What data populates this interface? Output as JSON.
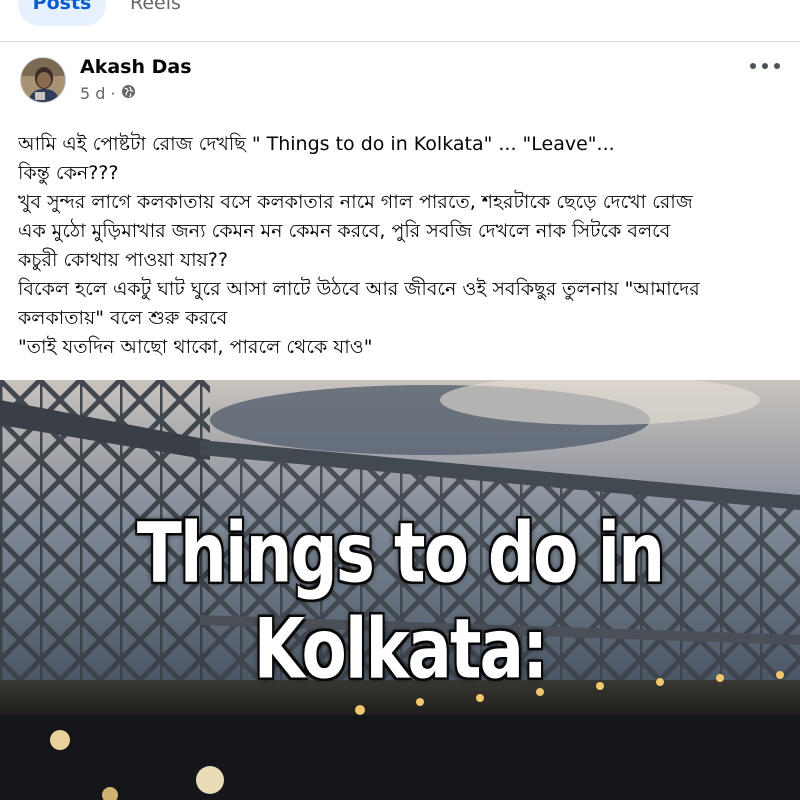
{
  "tabs": [
    {
      "label": "Posts",
      "active": true
    },
    {
      "label": "Reels",
      "active": false
    }
  ],
  "post": {
    "author": "Akash Das",
    "time": "5 d",
    "separator": "·",
    "audience_icon": "globe-icon",
    "more_icon": "more-options-icon",
    "text_lines": [
      "আমি এই পোষ্টটা রোজ দেখছি \" Things to do in Kolkata\" ... \"Leave\"...",
      "কিন্তু কেন???",
      "খুব সুন্দর লাগে কলকাতায় বসে কলকাতার নামে গাল পারতে, শহরটাকে ছেড়ে দেখো রোজ",
      "এক মুঠো মুড়িমাখার জন্য কেমন মন কেমন করবে, পুরি সবজি দেখলে নাক সিটকে বলবে",
      "কচুরী কোথায় পাওয়া যায়??",
      "বিকেল হলে একটু ঘাট ঘুরে আসা লাটে উঠবে আর জীবনে ওই সবকিছুর তুলনায় \"আমাদের",
      "কলকাতায়\" বলে শুরু করবে",
      "\"তাই যতদিন আছো থাকো, পারলে থেকে যাও\""
    ],
    "image_caption": "Things to do in Kolkata:"
  },
  "colors": {
    "accent": "#0a5dcf",
    "tab_active_bg": "#e7f0fd",
    "secondary_text": "#65676b",
    "divider": "#dcdfe3"
  }
}
